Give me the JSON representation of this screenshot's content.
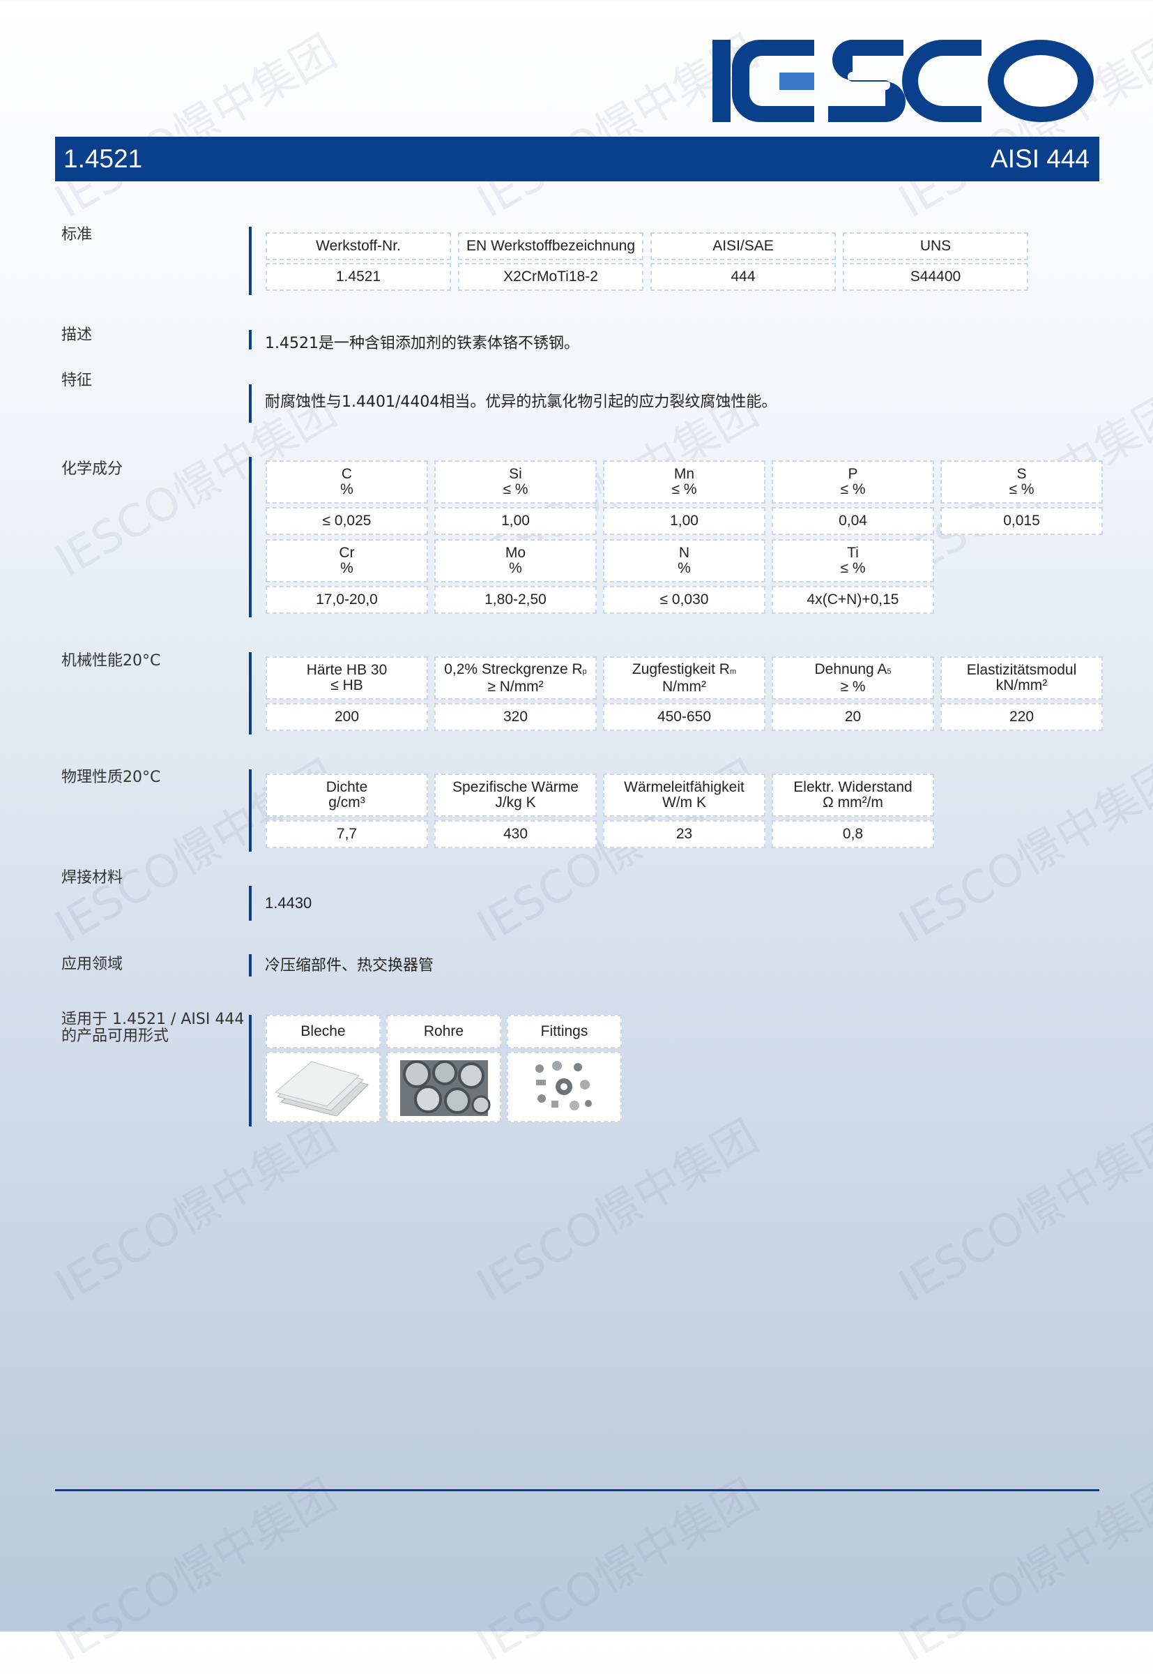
{
  "watermark_text": "IESCO憬中集团",
  "logo": {
    "text": "IESCO",
    "colors": {
      "primary": "#0a3f8c",
      "accent": "#3a78c9"
    }
  },
  "header": {
    "left_title": "1.4521",
    "right_title": "AISI 444"
  },
  "labels": {
    "standard": "标准",
    "description": "描述",
    "features": "特征",
    "chemical": "化学成分",
    "mechanical": "机械性能20°C",
    "physical": "物理性质20°C",
    "welding": "焊接材料",
    "application": "应用领域",
    "forms_line1": "适用于 1.4521 / AISI 444",
    "forms_line2": "的产品可用形式"
  },
  "standards": {
    "headers": [
      "Werkstoff-Nr.",
      "EN Werkstoffbezeichnung",
      "AISI/SAE",
      "UNS"
    ],
    "values": [
      "1.4521",
      "X2CrMoTi18-2",
      "444",
      "S44400"
    ]
  },
  "description_text": "1.4521是一种含钼添加剂的铁素体铬不锈钢。",
  "features_text": "耐腐蚀性与1.4401/4404相当。优异的抗氯化物引起的应力裂纹腐蚀性能。",
  "chemical": {
    "row1": [
      {
        "el": "C",
        "unit": "%",
        "value": "≤ 0,025"
      },
      {
        "el": "Si",
        "unit": "≤ %",
        "value": "1,00"
      },
      {
        "el": "Mn",
        "unit": "≤ %",
        "value": "1,00"
      },
      {
        "el": "P",
        "unit": "≤ %",
        "value": "0,04"
      },
      {
        "el": "S",
        "unit": "≤ %",
        "value": "0,015"
      }
    ],
    "row2": [
      {
        "el": "Cr",
        "unit": "%",
        "value": "17,0-20,0"
      },
      {
        "el": "Mo",
        "unit": "%",
        "value": "1,80-2,50"
      },
      {
        "el": "N",
        "unit": "%",
        "value": "≤ 0,030"
      },
      {
        "el": "Ti",
        "unit": "≤ %",
        "value": "4x(C+N)+0,15"
      }
    ]
  },
  "mechanical": [
    {
      "name": "Härte HB 30",
      "sub": "",
      "unit": "≤ HB",
      "value": "200"
    },
    {
      "name": "0,2% Streckgrenze R",
      "sub": "p",
      "unit": "≥ N/mm²",
      "value": "320"
    },
    {
      "name": "Zugfestigkeit R",
      "sub": "m",
      "unit": "N/mm²",
      "value": "450-650"
    },
    {
      "name": "Dehnung A",
      "sub": "5",
      "unit": "≥ %",
      "value": "20"
    },
    {
      "name": "Elastizitätsmodul",
      "sub": "",
      "unit": "kN/mm²",
      "value": "220"
    }
  ],
  "physical": [
    {
      "name": "Dichte",
      "unit": "g/cm³",
      "value": "7,7"
    },
    {
      "name": "Spezifische Wärme",
      "unit": "J/kg K",
      "value": "430"
    },
    {
      "name": "Wärmeleitfähigkeit",
      "unit": "W/m K",
      "value": "23"
    },
    {
      "name": "Elektr. Widerstand",
      "unit": "Ω mm²/m",
      "value": "0,8"
    }
  ],
  "welding_text": "1.4430",
  "application_text": "冷压缩部件、热交换器管",
  "forms": [
    "Bleche",
    "Rohre",
    "Fittings"
  ]
}
